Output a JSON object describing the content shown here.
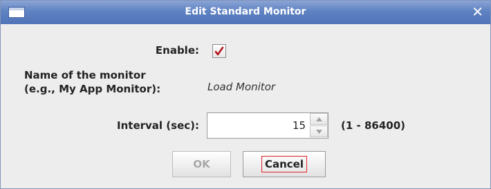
{
  "window": {
    "title": "Edit Standard Monitor",
    "close_glyph": "✕",
    "titlebar_icon": "window-icon"
  },
  "form": {
    "enable_label": "Enable:",
    "enable_checked": true,
    "name_label_line1": "Name of the monitor",
    "name_label_line2": "(e.g., My App Monitor):",
    "name_value": "Load Monitor",
    "interval_label": "Interval (sec):",
    "interval_value": "15",
    "interval_range": "(1 - 86400)"
  },
  "buttons": {
    "ok_label": "OK",
    "ok_enabled": false,
    "cancel_label": "Cancel"
  },
  "colors": {
    "titlebar": "#5f82c2",
    "checkmark": "#b3121d",
    "focus_ring": "#e0222b"
  }
}
